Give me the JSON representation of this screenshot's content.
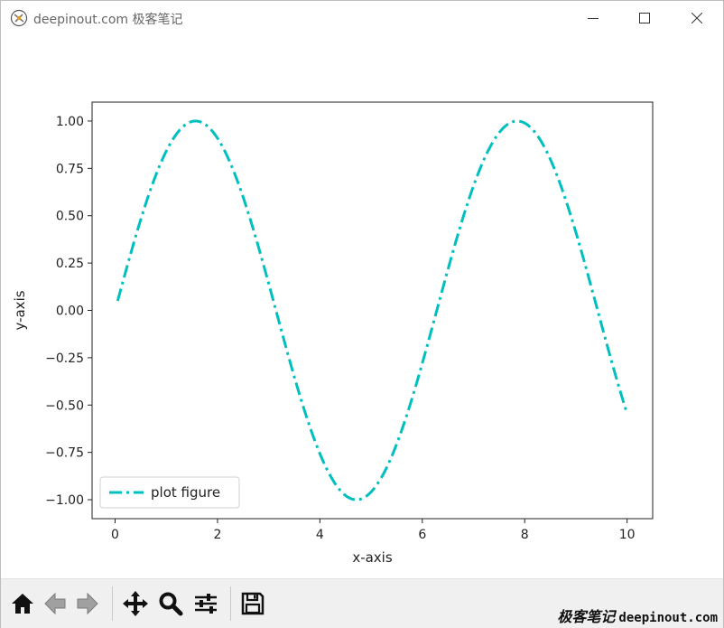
{
  "window": {
    "title": "deepinout.com 极客笔记",
    "controls": [
      "minimize",
      "maximize",
      "close"
    ]
  },
  "toolbar": {
    "buttons": [
      {
        "name": "home",
        "icon": "home-icon"
      },
      {
        "name": "back",
        "icon": "arrow-left-icon"
      },
      {
        "name": "forward",
        "icon": "arrow-right-icon"
      },
      {
        "name": "pan",
        "icon": "move-icon"
      },
      {
        "name": "zoom",
        "icon": "magnifier-icon"
      },
      {
        "name": "configure-subplots",
        "icon": "sliders-icon"
      },
      {
        "name": "save",
        "icon": "floppy-disk-icon"
      }
    ]
  },
  "watermark": {
    "cn": "极客笔记",
    "url": "deepinout.com"
  },
  "chart_data": {
    "type": "line",
    "title": "",
    "xlabel": "x-axis",
    "ylabel": "y-axis",
    "xlim": [
      -0.45,
      10.5
    ],
    "ylim": [
      -1.1,
      1.1
    ],
    "x_ticks": [
      0,
      2,
      4,
      6,
      8,
      10
    ],
    "x_tick_labels": [
      "0",
      "2",
      "4",
      "6",
      "8",
      "10"
    ],
    "y_ticks": [
      1.0,
      0.75,
      0.5,
      0.25,
      0.0,
      -0.25,
      -0.5,
      -0.75,
      -1.0
    ],
    "y_tick_labels": [
      "1.00",
      "0.75",
      "0.50",
      "0.25",
      "0.00",
      "−0.25",
      "−0.50",
      "−0.75",
      "−1.00"
    ],
    "grid": false,
    "legend": "lower-left",
    "series": [
      {
        "name": "plot figure",
        "color": "#00bfbf",
        "linestyle": "dashdot",
        "function": "sin",
        "x": [
          0.05,
          0.5,
          1.0,
          1.5708,
          2.0,
          2.5,
          3.0,
          3.5,
          4.0,
          4.7124,
          5.0,
          5.5,
          6.0,
          6.5,
          7.0,
          7.854,
          8.5,
          9.0,
          9.5,
          10.0
        ],
        "y": [
          0.05,
          0.479,
          0.841,
          1.0,
          0.909,
          0.598,
          0.141,
          -0.351,
          -0.757,
          -1.0,
          -0.959,
          -0.706,
          -0.279,
          0.215,
          0.657,
          1.0,
          0.798,
          0.412,
          -0.075,
          -0.544
        ]
      }
    ]
  }
}
